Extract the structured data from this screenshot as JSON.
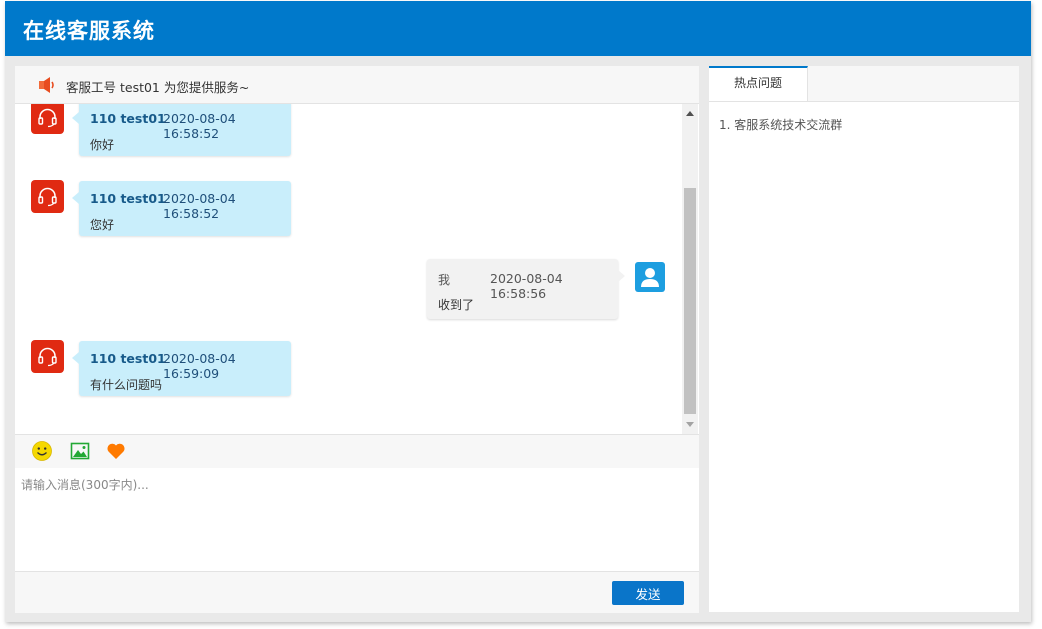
{
  "app": {
    "title": "在线客服系统"
  },
  "notice": {
    "text": "客服工号 test01 为您提供服务~"
  },
  "messages": [
    {
      "from": "agent",
      "name": "110 test01",
      "time": "2020-08-04 16:58:52",
      "text": "你好"
    },
    {
      "from": "agent",
      "name": "110 test01",
      "time": "2020-08-04 16:58:52",
      "text": "您好"
    },
    {
      "from": "me",
      "name": "我",
      "time": "2020-08-04 16:58:56",
      "text": "收到了"
    },
    {
      "from": "agent",
      "name": "110 test01",
      "time": "2020-08-04 16:59:09",
      "text": "有什么问题吗"
    }
  ],
  "toolbar": {
    "icons": [
      "emoji-icon",
      "image-icon",
      "heart-icon"
    ]
  },
  "input": {
    "placeholder": "请输入消息(300字内)...",
    "value": ""
  },
  "footer": {
    "send_label": "发送"
  },
  "sidebar": {
    "tab_label": "热点问题",
    "faq": [
      "1. 客服系统技术交流群"
    ]
  },
  "colors": {
    "brand": "#0079cb",
    "agent_avatar": "#e02a12",
    "agent_bubble": "#c9eefb",
    "my_bubble": "#f2f2f2",
    "my_avatar": "#1d9ee0",
    "send_button": "#0a75c9"
  }
}
